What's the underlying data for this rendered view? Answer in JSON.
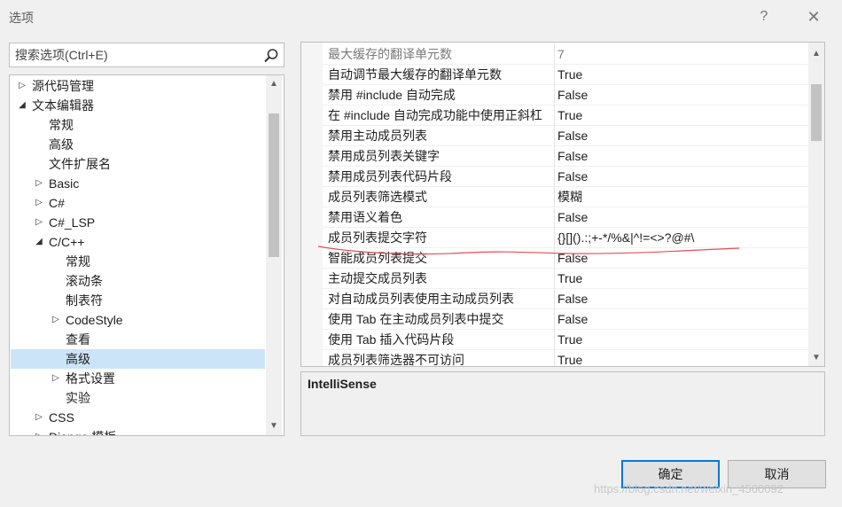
{
  "window": {
    "title": "选项",
    "help_label": "?",
    "close_label": "✕"
  },
  "search": {
    "placeholder": "搜索选项(Ctrl+E)"
  },
  "tree": {
    "items": [
      {
        "label": "源代码管理",
        "level": 0,
        "expander": "collapsed"
      },
      {
        "label": "文本编辑器",
        "level": 0,
        "expander": "expanded"
      },
      {
        "label": "常规",
        "level": 1,
        "expander": "none"
      },
      {
        "label": "高级",
        "level": 1,
        "expander": "none"
      },
      {
        "label": "文件扩展名",
        "level": 1,
        "expander": "none"
      },
      {
        "label": "Basic",
        "level": 1,
        "expander": "collapsed"
      },
      {
        "label": "C#",
        "level": 1,
        "expander": "collapsed"
      },
      {
        "label": "C#_LSP",
        "level": 1,
        "expander": "collapsed"
      },
      {
        "label": "C/C++",
        "level": 1,
        "expander": "expanded"
      },
      {
        "label": "常规",
        "level": 2,
        "expander": "none"
      },
      {
        "label": "滚动条",
        "level": 2,
        "expander": "none"
      },
      {
        "label": "制表符",
        "level": 2,
        "expander": "none"
      },
      {
        "label": "CodeStyle",
        "level": 2,
        "expander": "collapsed"
      },
      {
        "label": "查看",
        "level": 2,
        "expander": "none"
      },
      {
        "label": "高级",
        "level": 2,
        "expander": "none",
        "selected": true
      },
      {
        "label": "格式设置",
        "level": 2,
        "expander": "collapsed"
      },
      {
        "label": "实验",
        "level": 2,
        "expander": "none"
      },
      {
        "label": "CSS",
        "level": 1,
        "expander": "collapsed"
      },
      {
        "label": "Django 模板",
        "level": 1,
        "expander": "collapsed"
      }
    ]
  },
  "properties": [
    {
      "name": "最大缓存的翻译单元数",
      "value": "7",
      "dim": true
    },
    {
      "name": "自动调节最大缓存的翻译单元数",
      "value": "True"
    },
    {
      "name": "禁用 #include 自动完成",
      "value": "False"
    },
    {
      "name": "在 #include 自动完成功能中使用正斜杠",
      "value": "True"
    },
    {
      "name": "禁用主动成员列表",
      "value": "False"
    },
    {
      "name": "禁用成员列表关键字",
      "value": "False"
    },
    {
      "name": "禁用成员列表代码片段",
      "value": "False"
    },
    {
      "name": "成员列表筛选模式",
      "value": "模糊"
    },
    {
      "name": "禁用语义着色",
      "value": "False"
    },
    {
      "name": "成员列表提交字符",
      "value": "{}[]().:;+-*/%&|^!=<>?@#\\"
    },
    {
      "name": "智能成员列表提交",
      "value": "False"
    },
    {
      "name": "主动提交成员列表",
      "value": "True"
    },
    {
      "name": "对自动成员列表使用主动成员列表",
      "value": "False"
    },
    {
      "name": "使用 Tab 在主动成员列表中提交",
      "value": "False"
    },
    {
      "name": "使用 Tab 插入代码片段",
      "value": "True"
    },
    {
      "name": "成员列表筛选器不可访问",
      "value": "True"
    }
  ],
  "description": {
    "title": "IntelliSense"
  },
  "buttons": {
    "ok": "确定",
    "cancel": "取消"
  },
  "watermark": "https://blog.csdn.net/weixin_4560092",
  "colors": {
    "selection": "#cce4f7",
    "accent": "#0078d7",
    "annotation": "#e0303a"
  }
}
